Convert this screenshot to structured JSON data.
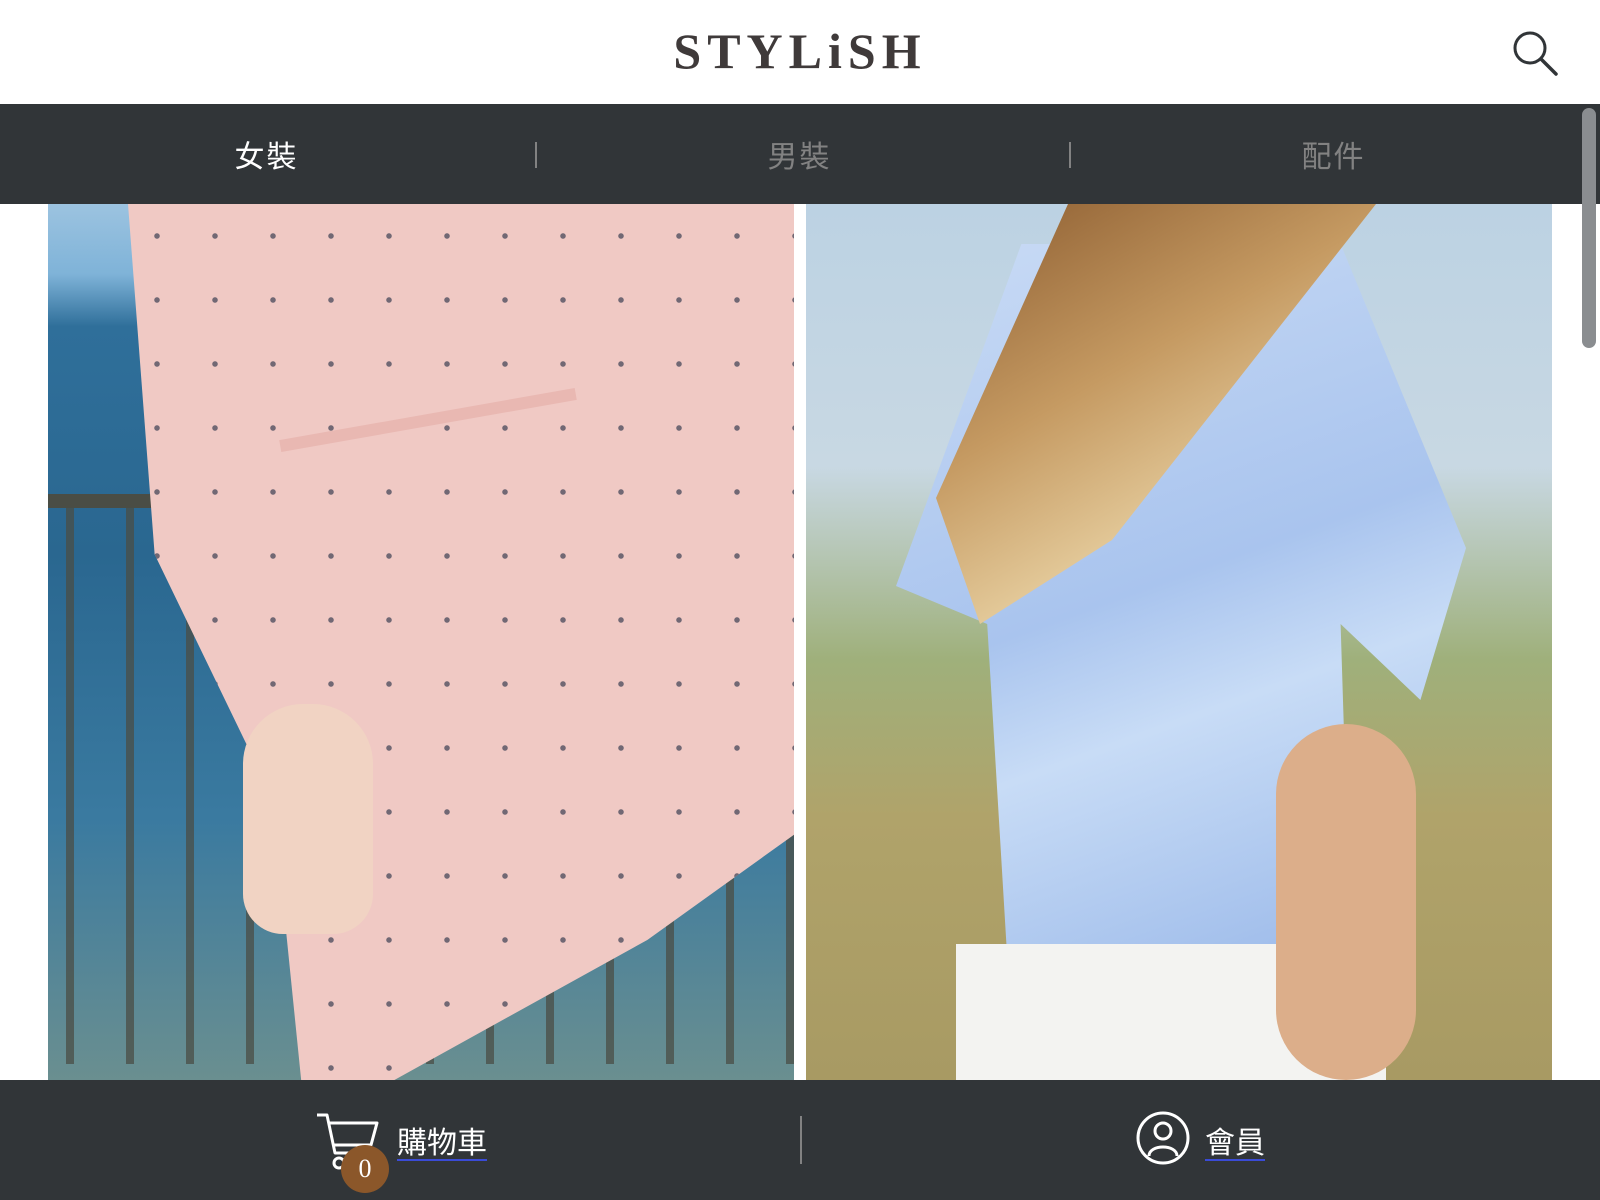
{
  "header": {
    "logo_text": "STYLiSH",
    "search_icon": "search-icon"
  },
  "categories": [
    {
      "label": "女裝",
      "active": true
    },
    {
      "label": "男裝",
      "active": false
    },
    {
      "label": "配件",
      "active": false
    }
  ],
  "products": [
    {
      "image": "woman in pink bird-print wrap dress by the sea"
    },
    {
      "image": "woman in light blue blouse in a field"
    }
  ],
  "bottom_nav": {
    "cart": {
      "label": "購物車",
      "count": "0",
      "icon": "cart-icon"
    },
    "member": {
      "label": "會員",
      "icon": "member-icon"
    }
  },
  "colors": {
    "bar_background": "#313538",
    "active_category": "#ffffff",
    "inactive_category": "#828282",
    "badge": "#8b572a"
  }
}
